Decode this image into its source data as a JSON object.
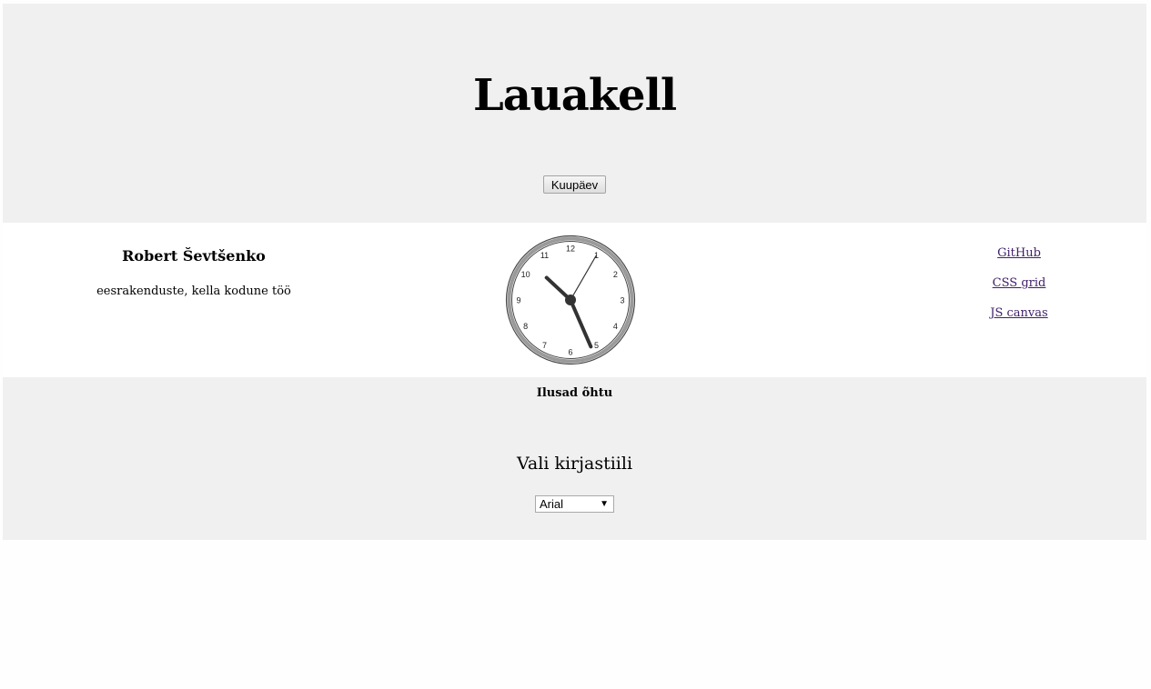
{
  "header": {
    "title": "Lauakell",
    "date_button_label": "Kuupäev"
  },
  "author": {
    "name": "Robert Ševtšenko",
    "description": "eesrakenduste, kella kodune töö"
  },
  "clock": {
    "numbers": [
      "12",
      "1",
      "2",
      "3",
      "4",
      "5",
      "6",
      "7",
      "8",
      "9",
      "10",
      "11"
    ],
    "time": {
      "hour": 10,
      "minute": 26,
      "second": 5
    }
  },
  "links": [
    {
      "label": "GitHub"
    },
    {
      "label": "CSS grid"
    },
    {
      "label": "JS canvas"
    }
  ],
  "footer": {
    "greeting": "Ilusad õhtu",
    "font_title": "Vali kirjastiili",
    "font_select_value": "Arial",
    "font_select_arrow": "▼"
  }
}
